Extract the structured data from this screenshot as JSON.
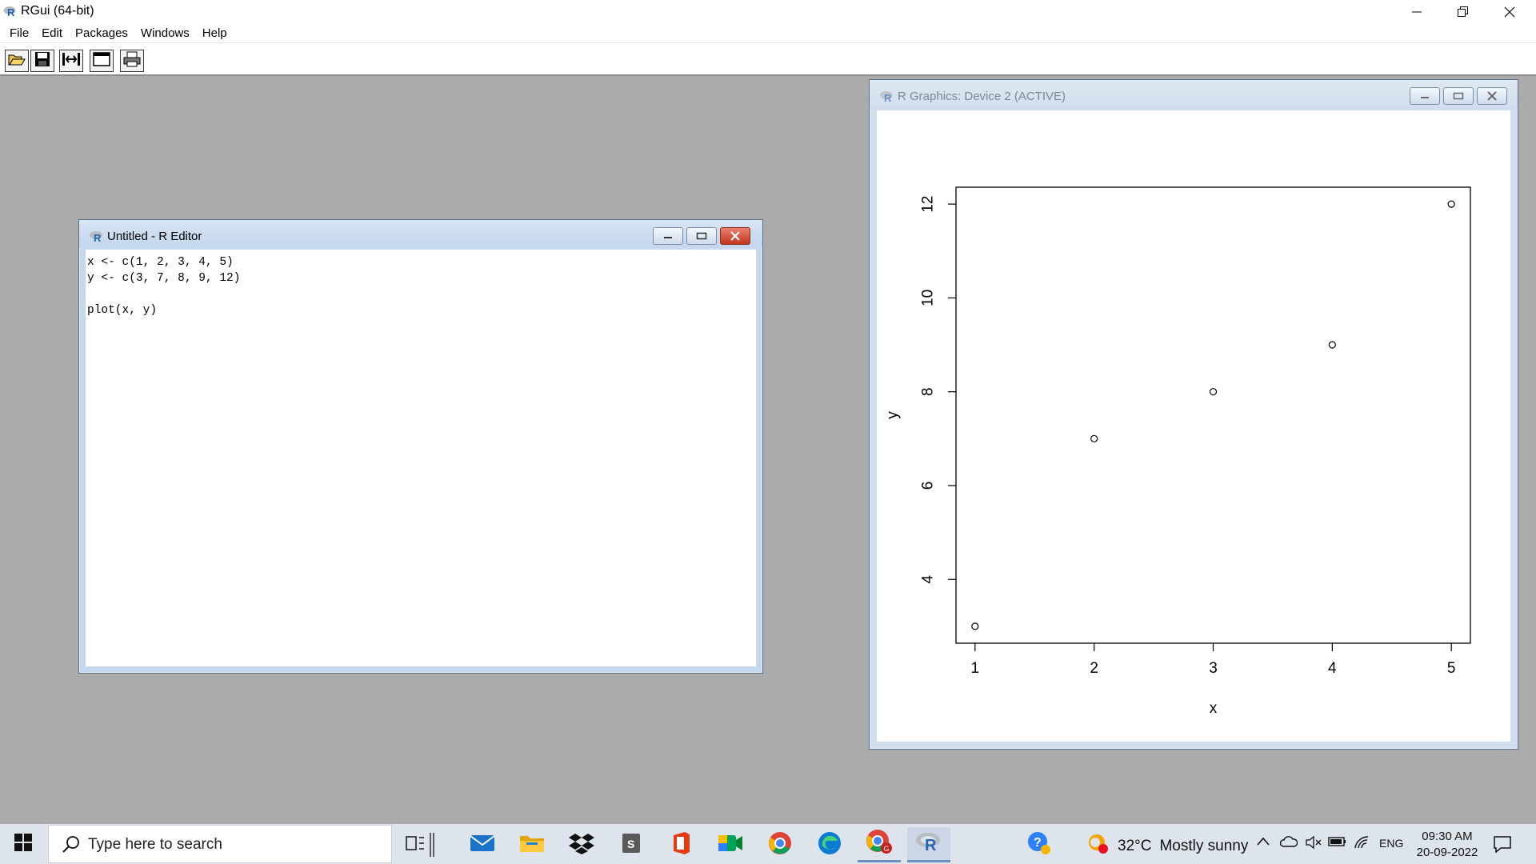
{
  "app": {
    "title": "RGui (64-bit)",
    "menu": [
      "File",
      "Edit",
      "Packages",
      "Windows",
      "Help"
    ],
    "toolbar_icons": [
      "open-script-icon",
      "save-icon",
      "load-workspace-icon",
      "console-icon",
      "print-icon"
    ]
  },
  "editor": {
    "title": "Untitled - R Editor",
    "lines": [
      "x <- c(1, 2, 3, 4, 5)",
      "y <- c(3, 7, 8, 9, 12)",
      "",
      "plot(x, y)"
    ]
  },
  "graphics": {
    "title": "R Graphics: Device 2 (ACTIVE)"
  },
  "chart_data": {
    "type": "scatter",
    "x": [
      1,
      2,
      3,
      4,
      5
    ],
    "y": [
      3,
      7,
      8,
      9,
      12
    ],
    "xlabel": "x",
    "ylabel": "y",
    "xlim": [
      0.84,
      5.16
    ],
    "ylim": [
      2.64,
      12.36
    ],
    "xticks": [
      "1",
      "2",
      "3",
      "4",
      "5"
    ],
    "yticks": [
      "4",
      "6",
      "8",
      "10",
      "12"
    ],
    "xtick_values": [
      1,
      2,
      3,
      4,
      5
    ],
    "ytick_values": [
      4,
      6,
      8,
      10,
      12
    ],
    "grid": false,
    "marker": "open-circle"
  },
  "taskbar": {
    "search_placeholder": "Type here to search",
    "weather": {
      "temp": "32°C",
      "condition": "Mostly sunny"
    },
    "language": "ENG",
    "time": "09:30 AM",
    "date": "20-09-2022"
  }
}
